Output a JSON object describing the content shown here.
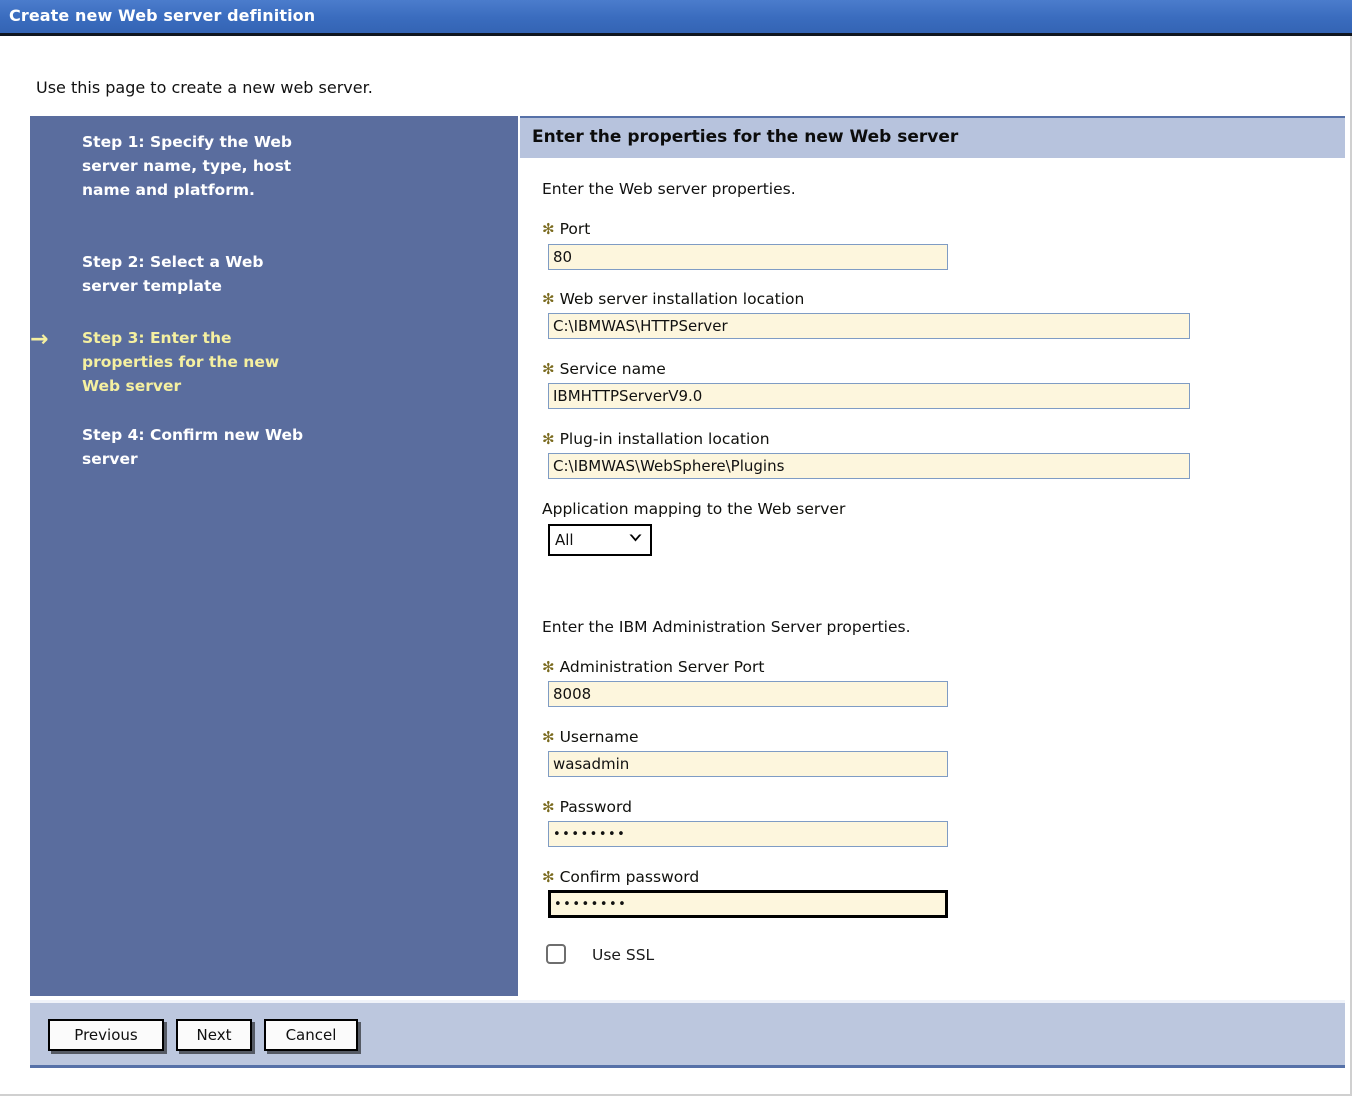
{
  "window": {
    "title": "Create new Web server definition"
  },
  "intro": "Use this page to create a new web server.",
  "sidebar": {
    "active_index": 2,
    "arrow_glyph": "→",
    "steps": [
      {
        "label": "Step 1: Specify the Web server name, type, host name and platform.",
        "active": false
      },
      {
        "label": "Step 2: Select a Web server template",
        "active": false
      },
      {
        "label": "Step 3: Enter the properties for the new Web server",
        "active": true
      },
      {
        "label": "Step 4: Confirm new Web server",
        "active": false
      }
    ]
  },
  "content": {
    "header": "Enter the properties for the new Web server",
    "webserver_section": {
      "intro": "Enter the Web server properties.",
      "fields": [
        {
          "label": "Port",
          "required": true,
          "value": "80",
          "placeholder": ""
        },
        {
          "label": "Web server installation location",
          "required": true,
          "value": "C:\\IBMWAS\\HTTPServer",
          "placeholder": ""
        },
        {
          "label": "Service name",
          "required": true,
          "value": "IBMHTTPServerV9.0",
          "placeholder": ""
        },
        {
          "label": "Plug-in installation location",
          "required": true,
          "value": "C:\\IBMWAS\\WebSphere\\Plugins",
          "placeholder": ""
        }
      ],
      "dropdown": {
        "label": "Application mapping to the Web server",
        "required": false,
        "selected": "All",
        "options": [
          "All"
        ]
      }
    },
    "admin_section": {
      "intro": "Enter the IBM Administration Server properties.",
      "fields": [
        {
          "label": "Administration Server Port",
          "required": true,
          "value": "8008",
          "placeholder": ""
        },
        {
          "label": "Username",
          "required": true,
          "value": "wasadmin",
          "placeholder": ""
        },
        {
          "label": "Password",
          "required": true,
          "value": "••••••••",
          "placeholder": "",
          "masked": true
        },
        {
          "label": "Confirm password",
          "required": true,
          "value": "••••••••",
          "placeholder": "",
          "masked": true,
          "focused": true
        }
      ],
      "checkbox": {
        "label": "Use SSL",
        "checked": false
      }
    }
  },
  "footer": {
    "buttons": [
      {
        "label": "Previous"
      },
      {
        "label": "Next"
      },
      {
        "label": "Cancel"
      }
    ]
  },
  "required_marker": "✻",
  "colors": {
    "titlebar_blue": "#3a6cbe",
    "sidebar_blue": "#5a6d9e",
    "header_blue": "#b7c3dd",
    "footer_blue": "#bcc7de",
    "input_cream": "#fdf6dd",
    "input_border": "#7f9cc4",
    "active_step_yellow": "#f5f0a0",
    "required_star": "#7a6a1e"
  }
}
